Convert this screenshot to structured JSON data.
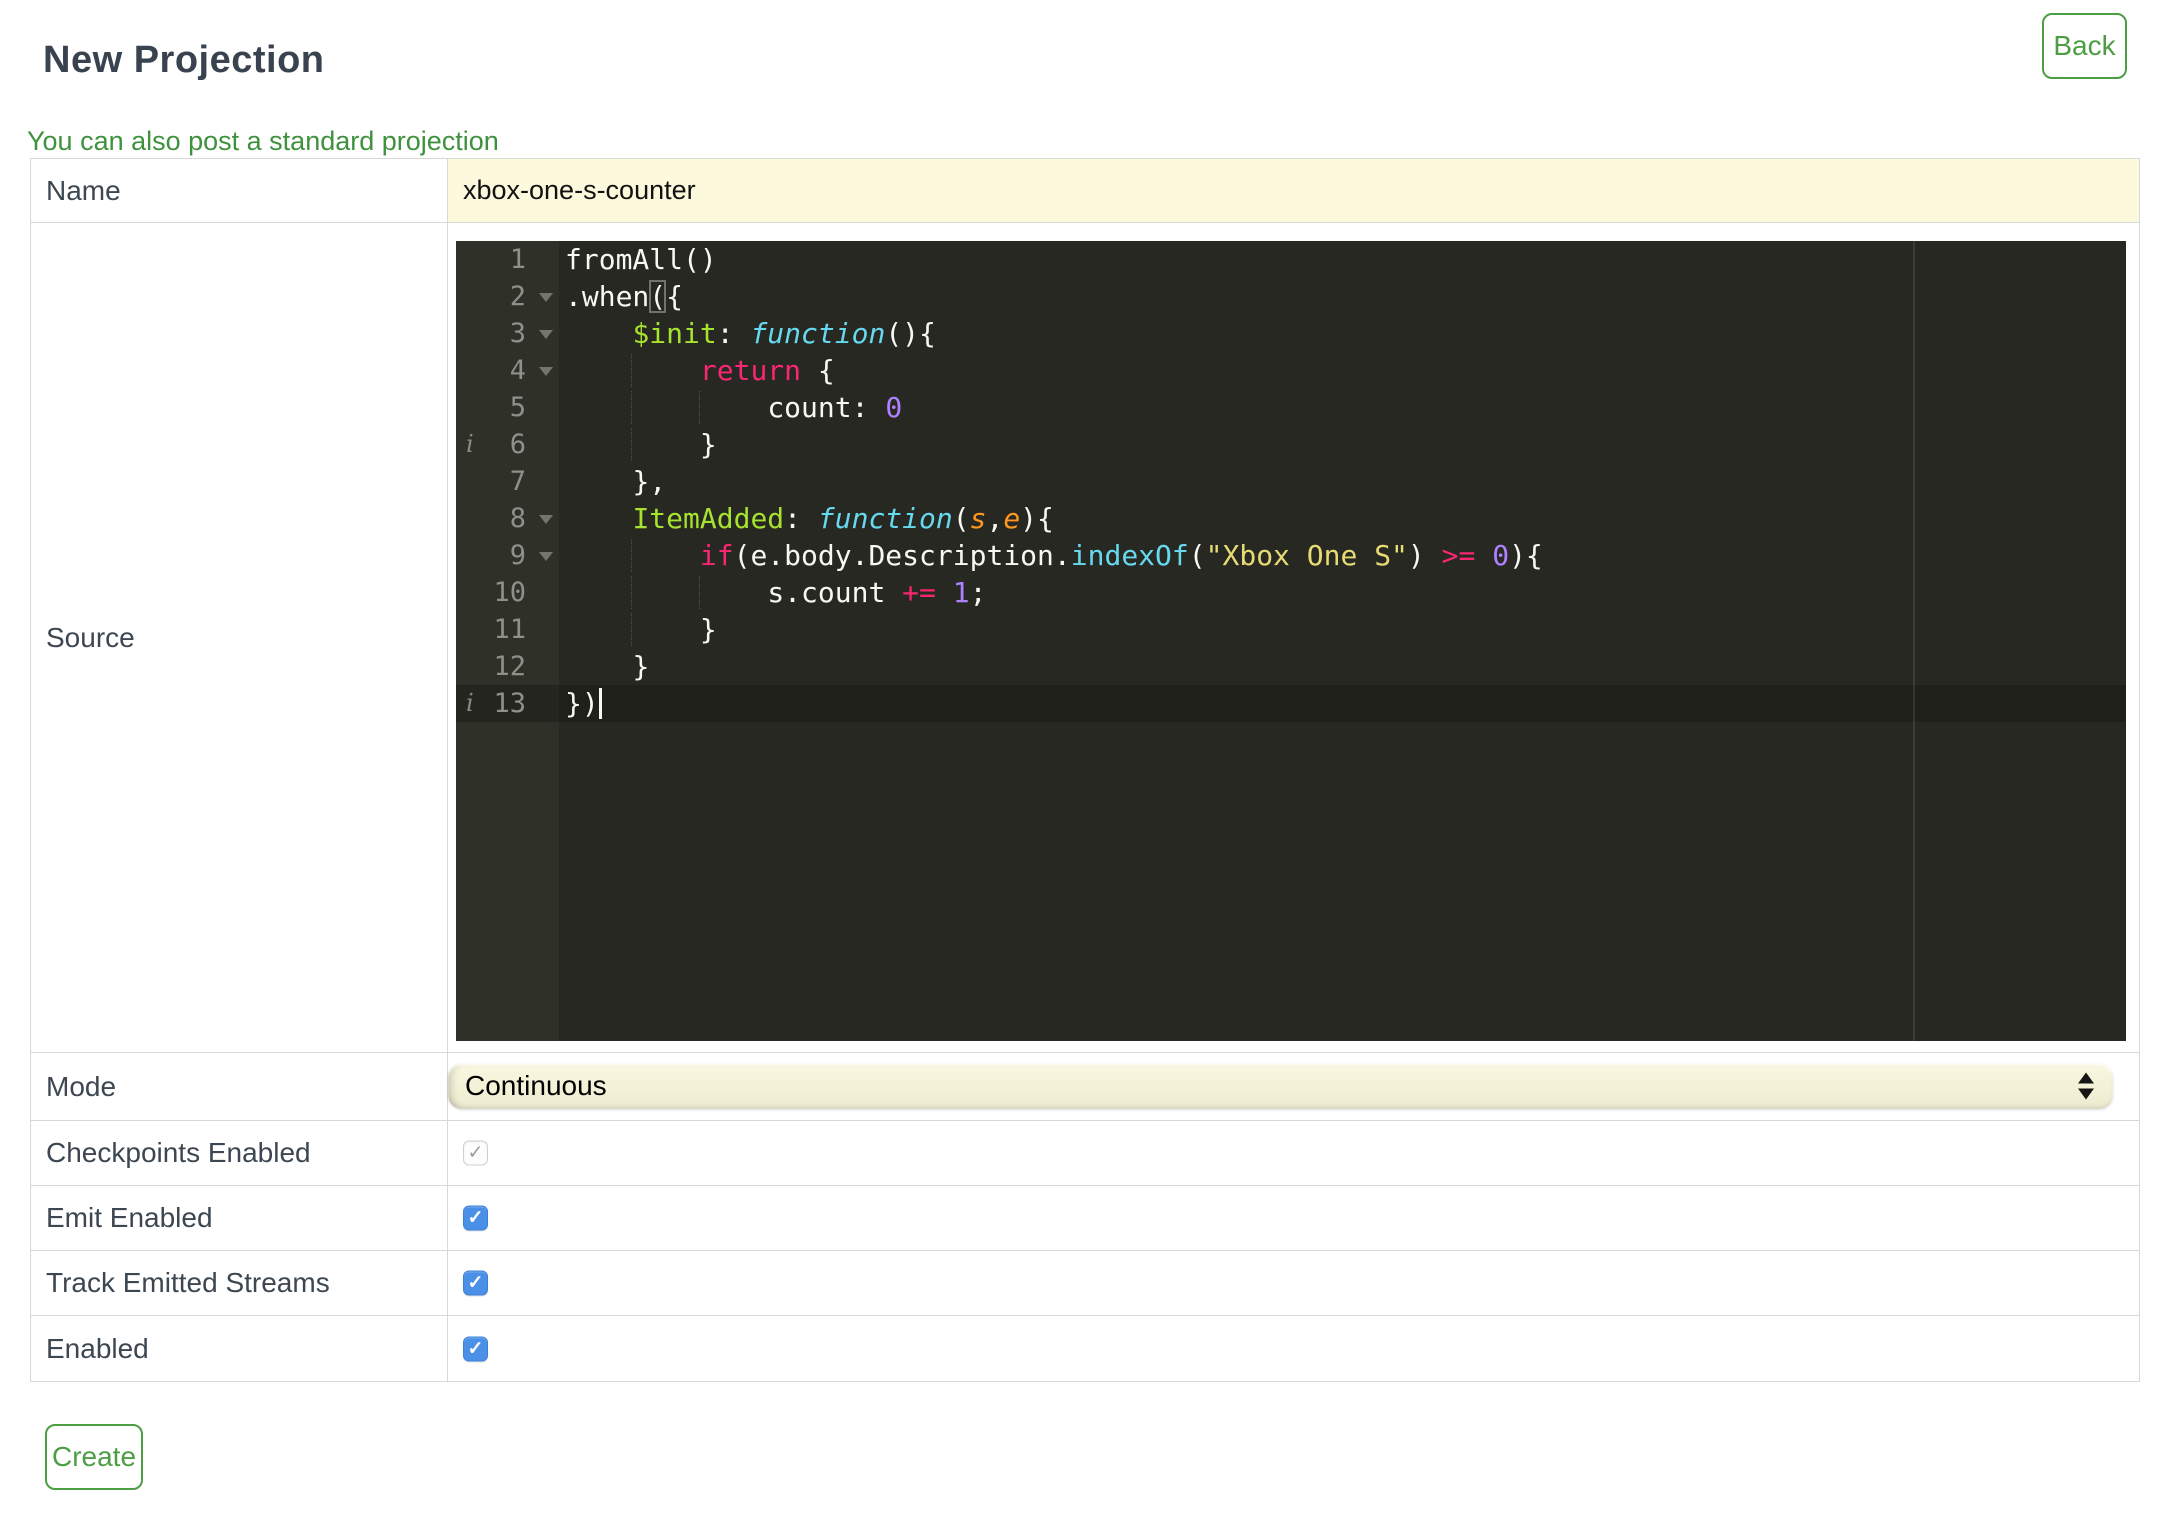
{
  "page": {
    "title": "New Projection",
    "back_label": "Back",
    "hint_link": "You can also post a standard projection",
    "create_label": "Create"
  },
  "colors": {
    "accent_green": "#4d9d44",
    "link_green": "#3f923d",
    "border_gray": "#d9d9d3",
    "name_bg": "#fcf9dc",
    "checkbox_blue": "#4a90e6",
    "editor_bg": "#272822",
    "gutter_bg": "#2f3129"
  },
  "icons": {
    "check_glyph": "✓"
  },
  "form": {
    "name": {
      "label": "Name",
      "value": "xbox-one-s-counter"
    },
    "source": {
      "label": "Source"
    },
    "mode": {
      "label": "Mode",
      "value": "Continuous"
    },
    "checkpoints": {
      "label": "Checkpoints Enabled",
      "checked": true,
      "disabled": true
    },
    "emit": {
      "label": "Emit Enabled",
      "checked": true
    },
    "track": {
      "label": "Track Emitted Streams",
      "checked": true
    },
    "enabled": {
      "label": "Enabled",
      "checked": true
    }
  },
  "editor": {
    "info_glyph": "i",
    "lines": [
      {
        "num": 1,
        "indent": 0,
        "tokens": [
          [
            "t",
            "fromAll()"
          ]
        ]
      },
      {
        "num": 2,
        "indent": 0,
        "fold": true,
        "tokens": [
          [
            "t",
            ".when"
          ],
          [
            "b",
            "("
          ],
          [
            "t",
            "{"
          ]
        ]
      },
      {
        "num": 3,
        "indent": 4,
        "fold": true,
        "tokens": [
          [
            "g",
            "$init"
          ],
          [
            "t",
            ": "
          ],
          [
            "f",
            "function"
          ],
          [
            "t",
            "(){"
          ]
        ]
      },
      {
        "num": 4,
        "indent": 8,
        "fold": true,
        "tokens": [
          [
            "k",
            "return"
          ],
          [
            "t",
            " {"
          ]
        ]
      },
      {
        "num": 5,
        "indent": 12,
        "tokens": [
          [
            "t",
            "count: "
          ],
          [
            "n",
            "0"
          ]
        ]
      },
      {
        "num": 6,
        "indent": 8,
        "info": true,
        "tokens": [
          [
            "t",
            "}"
          ]
        ]
      },
      {
        "num": 7,
        "indent": 4,
        "tokens": [
          [
            "t",
            "},"
          ]
        ]
      },
      {
        "num": 8,
        "indent": 4,
        "fold": true,
        "tokens": [
          [
            "g",
            "ItemAdded"
          ],
          [
            "t",
            ": "
          ],
          [
            "f",
            "function"
          ],
          [
            "t",
            "("
          ],
          [
            "p",
            "s"
          ],
          [
            "t",
            ","
          ],
          [
            "p",
            "e"
          ],
          [
            "t",
            "){"
          ]
        ]
      },
      {
        "num": 9,
        "indent": 8,
        "fold": true,
        "tokens": [
          [
            "k",
            "if"
          ],
          [
            "t",
            "(e.body.Description."
          ],
          [
            "c",
            "indexOf"
          ],
          [
            "t",
            "("
          ],
          [
            "s",
            "\"Xbox One S\""
          ],
          [
            "t",
            ") "
          ],
          [
            "k",
            ">="
          ],
          [
            "t",
            " "
          ],
          [
            "n",
            "0"
          ],
          [
            "t",
            "){"
          ]
        ]
      },
      {
        "num": 10,
        "indent": 12,
        "tokens": [
          [
            "t",
            "s.count "
          ],
          [
            "k",
            "+="
          ],
          [
            "t",
            " "
          ],
          [
            "n",
            "1"
          ],
          [
            "t",
            ";"
          ]
        ]
      },
      {
        "num": 11,
        "indent": 8,
        "tokens": [
          [
            "t",
            "}"
          ]
        ]
      },
      {
        "num": 12,
        "indent": 4,
        "tokens": [
          [
            "t",
            "}"
          ]
        ]
      },
      {
        "num": 13,
        "indent": 0,
        "info": true,
        "active": true,
        "cursor": true,
        "tokens": [
          [
            "t",
            "})"
          ]
        ]
      }
    ]
  }
}
